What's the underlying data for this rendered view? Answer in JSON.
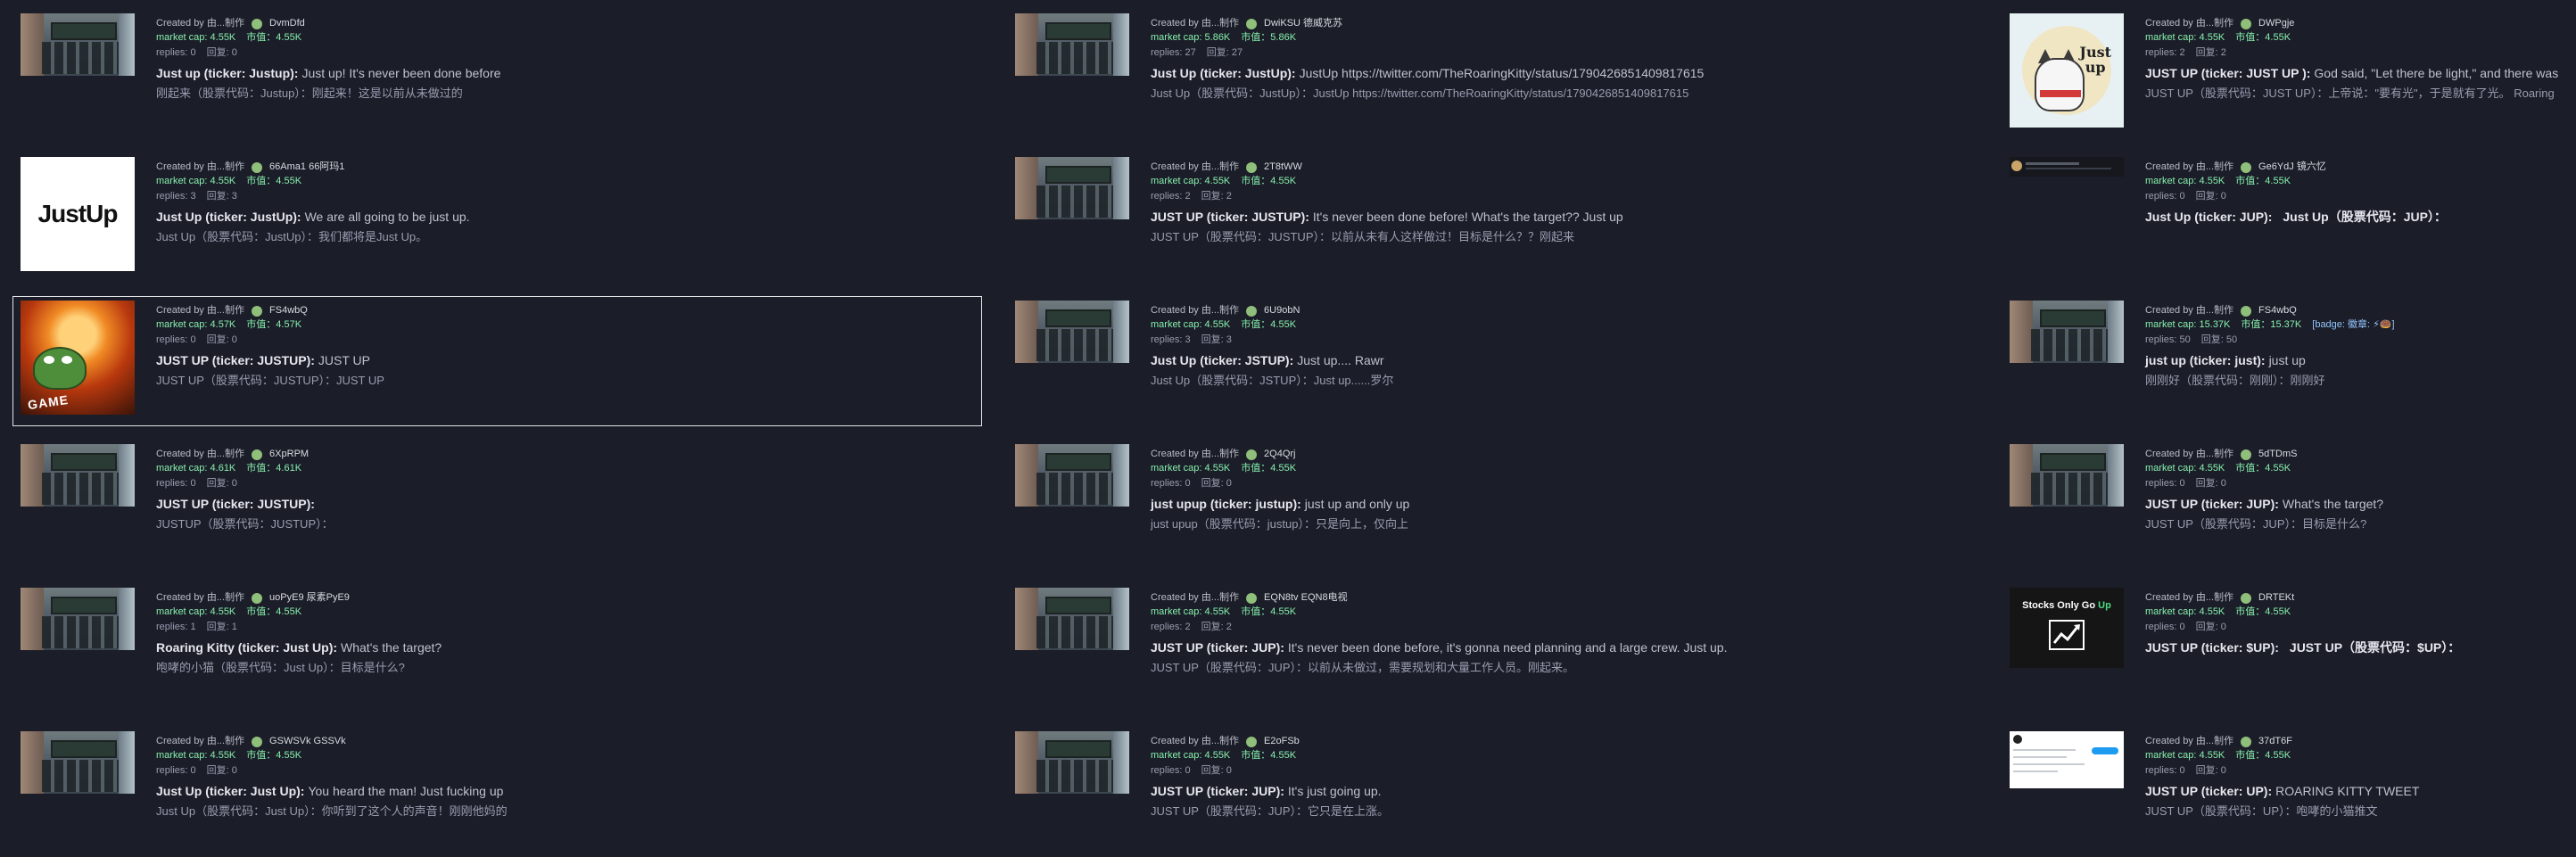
{
  "cards": [
    {
      "creator": "Created by 由...制作",
      "id": "DvmDfd",
      "mcap": "market cap: 4.55K",
      "mcap_cn": "市值：4.55K",
      "badge": "",
      "replies": "replies: 0",
      "replies_cn": "回复: 0",
      "ticker": "Just up (ticker: Justup):",
      "desc": "Just up! It's never been done before",
      "trans": "刚起来（股票代码：Justup）：刚起来！这是以前从未做过的",
      "thumb": "calc"
    },
    {
      "creator": "Created by 由...制作",
      "id": "DwiKSU  德威克苏",
      "mcap": "market cap: 5.86K",
      "mcap_cn": "市值：5.86K",
      "badge": "",
      "replies": "replies: 27",
      "replies_cn": "回复: 27",
      "ticker": "Just Up (ticker: JustUp):",
      "desc": "JustUp https://twitter.com/TheRoaringKitty/status/1790426851409817615",
      "trans": "Just Up（股票代码：JustUp）：JustUp https://twitter.com/TheRoaringKitty/status/1790426851409817615",
      "thumb": "calc"
    },
    {
      "creator": "Created by 由...制作",
      "id": "DWPgje",
      "mcap": "market cap: 4.55K",
      "mcap_cn": "市值：4.55K",
      "badge": "",
      "replies": "replies: 2",
      "replies_cn": "回复: 2",
      "ticker": "JUST UP (ticker: JUST UP ):",
      "desc": "God said, \"Let there be light,\" and there was light",
      "trans": "JUST UP（股票代码：JUST UP）：上帝说：\"要有光\"，于是就有了光。 Roaring",
      "thumb": "cat"
    },
    {
      "creator": "Created by 由...制作",
      "id": "66Ama1  66阿玛1",
      "mcap": "market cap: 4.55K",
      "mcap_cn": "市值：4.55K",
      "badge": "",
      "replies": "replies: 3",
      "replies_cn": "回复: 3",
      "ticker": "Just Up (ticker: JustUp):",
      "desc": "We are all going to be just up.",
      "trans": "Just Up（股票代码：JustUp）：我们都将是Just Up。",
      "thumb": "justup"
    },
    {
      "creator": "Created by 由...制作",
      "id": "2T8tWW",
      "mcap": "market cap: 4.55K",
      "mcap_cn": "市值：4.55K",
      "badge": "",
      "replies": "replies: 2",
      "replies_cn": "回复: 2",
      "ticker": "JUST UP (ticker: JUSTUP):",
      "desc": "It's never been done before! What's the target?? Just up",
      "trans": "JUST UP（股票代码：JUSTUP）：以前从未有人这样做过！目标是什么？？刚起来",
      "thumb": "calc"
    },
    {
      "creator": "Created by 由...制作",
      "id": "Ge6YdJ  镜六忆",
      "mcap": "market cap: 4.55K",
      "mcap_cn": "市值：4.55K",
      "badge": "",
      "replies": "replies: 0",
      "replies_cn": "回复: 0",
      "ticker": "Just Up (ticker: JUP):",
      "desc": "",
      "trans": "Just Up（股票代码：JUP）：",
      "inline_trans": true,
      "thumb": "tweet"
    },
    {
      "creator": "Created by 由...制作",
      "id": "FS4wbQ",
      "mcap": "market cap: 4.57K",
      "mcap_cn": "市值：4.57K",
      "badge": "",
      "replies": "replies: 0",
      "replies_cn": "回复: 0",
      "ticker": "JUST UP (ticker: JUSTUP):",
      "desc": "JUST UP",
      "trans": "JUST UP（股票代码：JUSTUP）：JUST UP",
      "thumb": "explosion",
      "selected": true
    },
    {
      "creator": "Created by 由...制作",
      "id": "6U9obN",
      "mcap": "market cap: 4.55K",
      "mcap_cn": "市值：4.55K",
      "badge": "",
      "replies": "replies: 3",
      "replies_cn": "回复: 3",
      "ticker": "Just Up (ticker: JSTUP):",
      "desc": "Just up.... Rawr",
      "trans": "Just Up（股票代码：JSTUP）：Just up......罗尔",
      "thumb": "calc"
    },
    {
      "creator": "Created by 由...制作",
      "id": "FS4wbQ",
      "mcap": "market cap: 15.37K",
      "mcap_cn": "市值：15.37K",
      "badge": "[badge: 徽章: ⚡🍩]",
      "replies": "replies: 50",
      "replies_cn": "回复: 50",
      "ticker": "just up (ticker: just):",
      "desc": "just up",
      "trans": "刚刚好（股票代码：刚刚）：刚刚好",
      "thumb": "calc"
    },
    {
      "creator": "Created by 由...制作",
      "id": "6XpRPM",
      "mcap": "market cap: 4.61K",
      "mcap_cn": "市值：4.61K",
      "badge": "",
      "replies": "replies: 0",
      "replies_cn": "回复: 0",
      "ticker": "JUST UP (ticker: JUSTUP):",
      "desc": "",
      "trans": "JUSTUP（股票代码：JUSTUP）：",
      "thumb": "calc"
    },
    {
      "creator": "Created by 由...制作",
      "id": "2Q4Qrj",
      "mcap": "market cap: 4.55K",
      "mcap_cn": "市值：4.55K",
      "badge": "",
      "replies": "replies: 0",
      "replies_cn": "回复: 0",
      "ticker": "just upup (ticker: justup):",
      "desc": "just up and only up",
      "trans": "just upup（股票代码：justup）：只是向上，仅向上",
      "thumb": "calc"
    },
    {
      "creator": "Created by 由...制作",
      "id": "5dTDmS",
      "mcap": "market cap: 4.55K",
      "mcap_cn": "市值：4.55K",
      "badge": "",
      "replies": "replies: 0",
      "replies_cn": "回复: 0",
      "ticker": "JUST UP (ticker: JUP):",
      "desc": "What's the target?",
      "trans": "JUST UP（股票代码：JUP）：目标是什么?",
      "thumb": "calc"
    },
    {
      "creator": "Created by 由...制作",
      "id": "uoPyE9  尿素PyE9",
      "mcap": "market cap: 4.55K",
      "mcap_cn": "市值：4.55K",
      "badge": "",
      "replies": "replies: 1",
      "replies_cn": "回复: 1",
      "ticker": "Roaring Kitty (ticker: Just Up):",
      "desc": "What's the target?",
      "trans": "咆哮的小猫（股票代码：Just Up）：目标是什么?",
      "thumb": "calc"
    },
    {
      "creator": "Created by 由...制作",
      "id": "EQN8tv  EQN8电视",
      "mcap": "market cap: 4.55K",
      "mcap_cn": "市值：4.55K",
      "badge": "",
      "replies": "replies: 2",
      "replies_cn": "回复: 2",
      "ticker": "JUST UP (ticker: JUP):",
      "desc": "It's never been done before, it's gonna need planning and a large crew. Just up.",
      "trans": "JUST UP（股票代码：JUP）：以前从未做过，需要规划和大量工作人员。刚起来。",
      "thumb": "calc"
    },
    {
      "creator": "Created by 由...制作",
      "id": "DRTEKt",
      "mcap": "market cap: 4.55K",
      "mcap_cn": "市值：4.55K",
      "badge": "",
      "replies": "replies: 0",
      "replies_cn": "回复: 0",
      "ticker": "JUST UP (ticker: $UP):",
      "desc": "",
      "trans": "JUST UP（股票代码：$UP）：",
      "inline_trans": true,
      "thumb": "stocks"
    },
    {
      "creator": "Created by 由...制作",
      "id": "GSWSVk  GSSVk",
      "mcap": "market cap: 4.55K",
      "mcap_cn": "市值：4.55K",
      "badge": "",
      "replies": "replies: 0",
      "replies_cn": "回复: 0",
      "ticker": "Just Up (ticker: Just Up):",
      "desc": "You heard the man! Just fucking up",
      "trans": "Just Up（股票代码：Just Up）：你听到了这个人的声音！刚刚他妈的",
      "thumb": "calc"
    },
    {
      "creator": "Created by 由...制作",
      "id": "E2oFSb",
      "mcap": "market cap: 4.55K",
      "mcap_cn": "市值：4.55K",
      "badge": "",
      "replies": "replies: 0",
      "replies_cn": "回复: 0",
      "ticker": "JUST UP (ticker: JUP):",
      "desc": "It's just going up.",
      "trans": "JUST UP（股票代码：JUP）：它只是在上涨。",
      "thumb": "calc"
    },
    {
      "creator": "Created by 由...制作",
      "id": "37dT6F",
      "mcap": "market cap: 4.55K",
      "mcap_cn": "市值：4.55K",
      "badge": "",
      "replies": "replies: 0",
      "replies_cn": "回复: 0",
      "ticker": "JUST UP (ticker: UP):",
      "desc": "ROARING KITTY TWEET",
      "trans": "JUST UP（股票代码：UP）：咆哮的小猫推文",
      "thumb": "tweet2"
    }
  ],
  "thumb_text": {
    "justup": "JustUp",
    "game": "GAME",
    "cat_line1": "Just",
    "cat_line2": "up",
    "stocks_a": "Stocks Only Go ",
    "stocks_b": "Up"
  }
}
